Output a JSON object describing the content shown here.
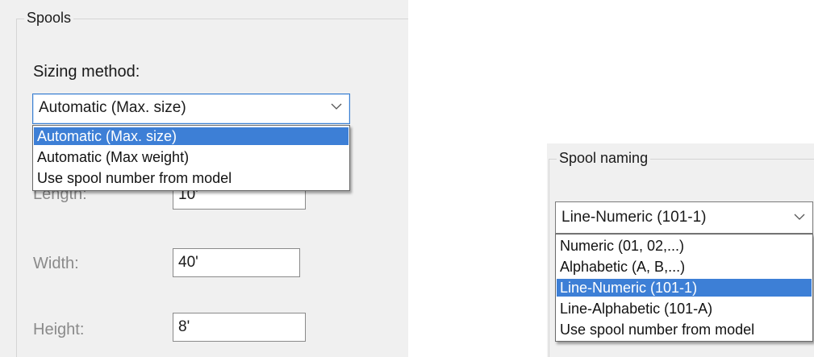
{
  "spools": {
    "group_title": "Spools",
    "sizing_label": "Sizing method:",
    "sizing_value": "Automatic (Max. size)",
    "sizing_options": [
      "Automatic (Max. size)",
      "Automatic (Max weight)",
      "Use spool number from model"
    ],
    "sizing_selected_index": 0,
    "length_label": "Length:",
    "length_value": "10'",
    "width_label": "Width:",
    "width_value": "40'",
    "height_label": "Height:",
    "height_value": "8'"
  },
  "naming": {
    "group_title": "Spool naming",
    "value": "Line-Numeric (101-1)",
    "options": [
      "Numeric (01, 02,...)",
      "Alphabetic (A, B,...)",
      "Line-Numeric (101-1)",
      "Line-Alphabetic (101-A)",
      "Use spool number from model"
    ],
    "selected_index": 2
  },
  "colors": {
    "selection": "#3d7fd6",
    "panel_bg": "#f0f0f0"
  },
  "icons": {
    "dropdown": "chevron-down-icon"
  }
}
